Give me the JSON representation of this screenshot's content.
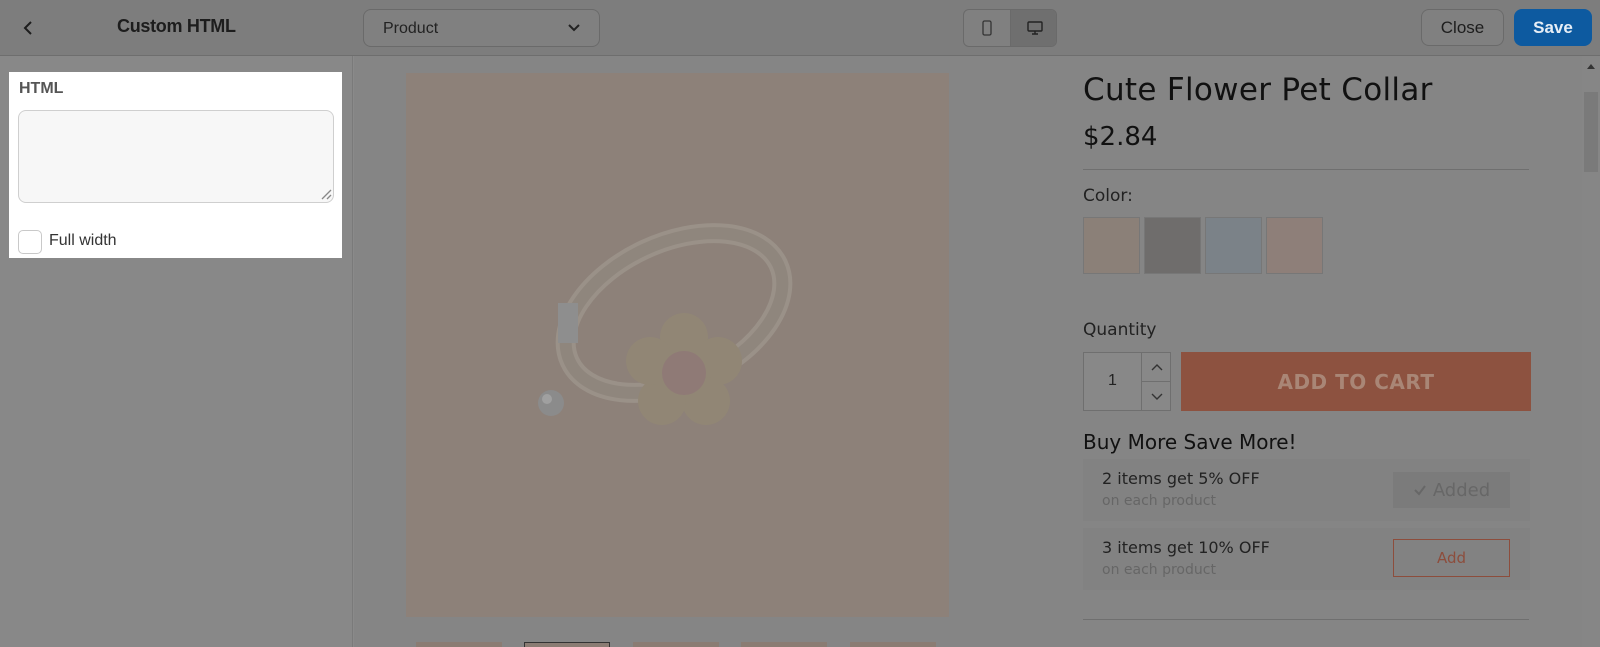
{
  "topbar": {
    "title": "Custom HTML",
    "page_select": "Product",
    "close_label": "Close",
    "save_label": "Save",
    "colors": {
      "save_bg": "#0d5aa0"
    }
  },
  "panel": {
    "html_label": "HTML",
    "html_value": "",
    "full_width_label": "Full width",
    "full_width_checked": false
  },
  "product": {
    "title": "Cute Flower Pet Collar",
    "price": "$2.84",
    "color_label": "Color:",
    "swatches": [
      "cream",
      "black",
      "blue",
      "pink"
    ],
    "quantity_label": "Quantity",
    "quantity": "1",
    "add_to_cart": "ADD TO CART",
    "bundle_title": "Buy More Save More!",
    "tiers": [
      {
        "title": "2 items get 5% OFF",
        "sub": "on each product",
        "button": "Added"
      },
      {
        "title": "3 items get 10% OFF",
        "sub": "on each product",
        "button": "Add"
      }
    ],
    "colors": {
      "add_to_cart_bg": "#e07a5f"
    }
  }
}
